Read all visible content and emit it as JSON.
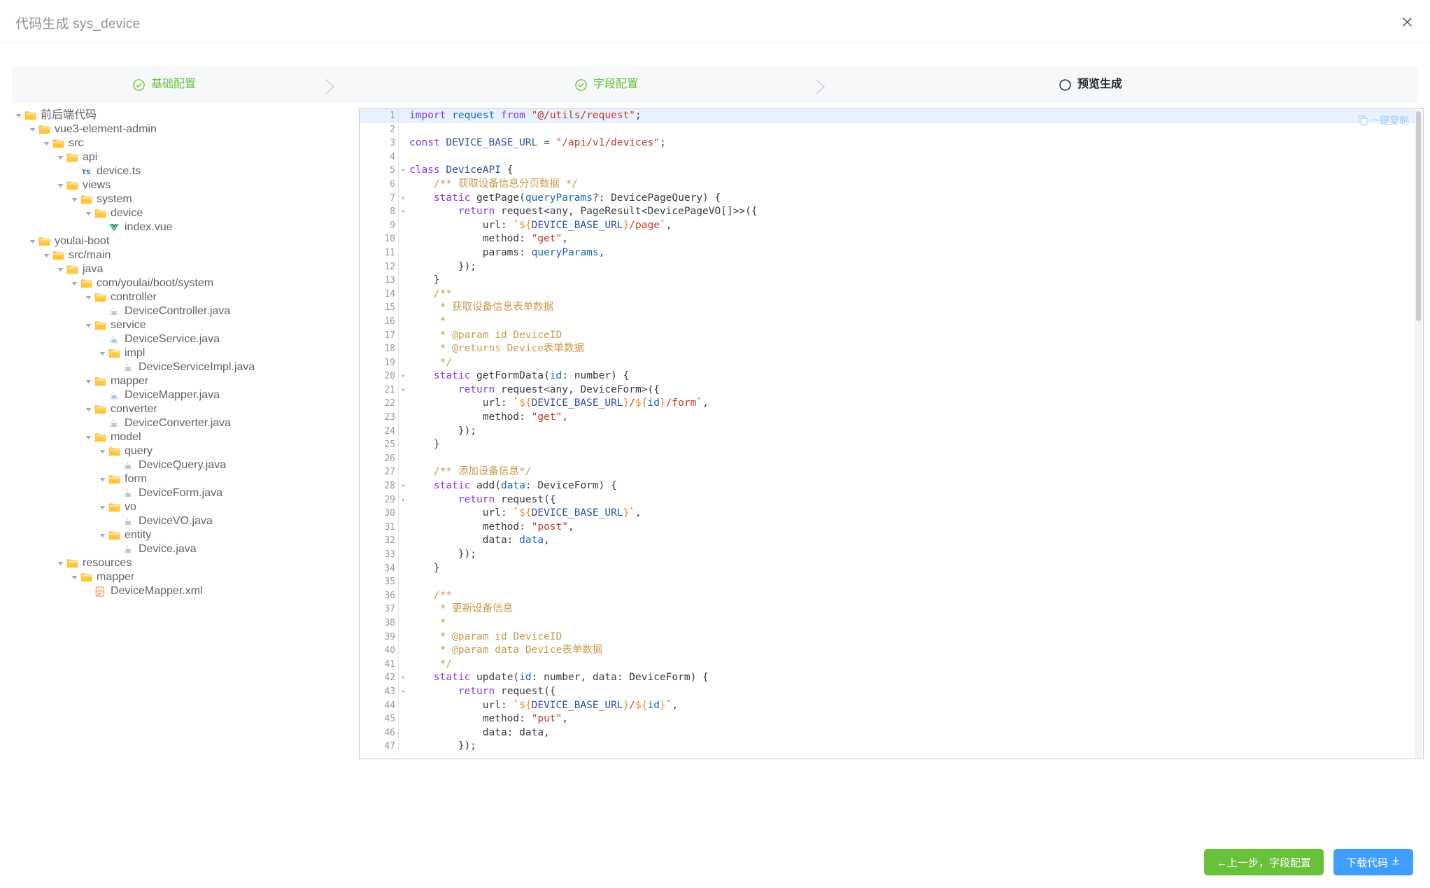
{
  "dialog": {
    "title": "代码生成 sys_device",
    "close_icon": "close-icon"
  },
  "steps": [
    {
      "label": "基础配置",
      "state": "done",
      "icon": "circle-check-icon"
    },
    {
      "label": "字段配置",
      "state": "done",
      "icon": "circle-check-icon"
    },
    {
      "label": "预览生成",
      "state": "active",
      "icon": "circle-icon"
    }
  ],
  "tree": [
    {
      "depth": 0,
      "label": "前后端代码",
      "type": "folder",
      "expanded": true
    },
    {
      "depth": 1,
      "label": "vue3-element-admin",
      "type": "folder",
      "expanded": true
    },
    {
      "depth": 2,
      "label": "src",
      "type": "folder",
      "expanded": true
    },
    {
      "depth": 3,
      "label": "api",
      "type": "folder",
      "expanded": true
    },
    {
      "depth": 4,
      "label": "device.ts",
      "type": "ts",
      "expanded": false
    },
    {
      "depth": 3,
      "label": "views",
      "type": "folder",
      "expanded": true
    },
    {
      "depth": 4,
      "label": "system",
      "type": "folder",
      "expanded": true
    },
    {
      "depth": 5,
      "label": "device",
      "type": "folder",
      "expanded": true
    },
    {
      "depth": 6,
      "label": "index.vue",
      "type": "vue",
      "expanded": false
    },
    {
      "depth": 1,
      "label": "youlai-boot",
      "type": "folder",
      "expanded": true
    },
    {
      "depth": 2,
      "label": "src/main",
      "type": "folder",
      "expanded": true
    },
    {
      "depth": 3,
      "label": "java",
      "type": "folder",
      "expanded": true
    },
    {
      "depth": 4,
      "label": "com/youlai/boot/system",
      "type": "folder",
      "expanded": true
    },
    {
      "depth": 5,
      "label": "controller",
      "type": "folder",
      "expanded": true
    },
    {
      "depth": 6,
      "label": "DeviceController.java",
      "type": "java",
      "expanded": false
    },
    {
      "depth": 5,
      "label": "service",
      "type": "folder",
      "expanded": true
    },
    {
      "depth": 6,
      "label": "DeviceService.java",
      "type": "java",
      "expanded": false
    },
    {
      "depth": 6,
      "label": "impl",
      "type": "folder",
      "expanded": true
    },
    {
      "depth": 7,
      "label": "DeviceServiceImpl.java",
      "type": "java",
      "expanded": false
    },
    {
      "depth": 5,
      "label": "mapper",
      "type": "folder",
      "expanded": true
    },
    {
      "depth": 6,
      "label": "DeviceMapper.java",
      "type": "java",
      "expanded": false
    },
    {
      "depth": 5,
      "label": "converter",
      "type": "folder",
      "expanded": true
    },
    {
      "depth": 6,
      "label": "DeviceConverter.java",
      "type": "java",
      "expanded": false
    },
    {
      "depth": 5,
      "label": "model",
      "type": "folder",
      "expanded": true
    },
    {
      "depth": 6,
      "label": "query",
      "type": "folder",
      "expanded": true
    },
    {
      "depth": 7,
      "label": "DeviceQuery.java",
      "type": "java",
      "expanded": false
    },
    {
      "depth": 6,
      "label": "form",
      "type": "folder",
      "expanded": true
    },
    {
      "depth": 7,
      "label": "DeviceForm.java",
      "type": "java",
      "expanded": false
    },
    {
      "depth": 6,
      "label": "vo",
      "type": "folder",
      "expanded": true
    },
    {
      "depth": 7,
      "label": "DeviceVO.java",
      "type": "java",
      "expanded": false
    },
    {
      "depth": 6,
      "label": "entity",
      "type": "folder",
      "expanded": true
    },
    {
      "depth": 7,
      "label": "Device.java",
      "type": "java",
      "expanded": false
    },
    {
      "depth": 3,
      "label": "resources",
      "type": "folder",
      "expanded": true
    },
    {
      "depth": 4,
      "label": "mapper",
      "type": "folder",
      "expanded": true
    },
    {
      "depth": 5,
      "label": "DeviceMapper.xml",
      "type": "xml",
      "expanded": false
    }
  ],
  "editor": {
    "copy_label": "一键复制",
    "copy_icon": "copy-icon",
    "active_line": 1,
    "fold_lines": [
      5,
      7,
      8,
      20,
      21,
      28,
      29,
      42,
      43
    ],
    "lines": [
      {
        "n": 1,
        "tokens": [
          [
            "kw",
            "import"
          ],
          [
            "plain",
            " "
          ],
          [
            "var",
            "request"
          ],
          [
            "plain",
            " "
          ],
          [
            "kw",
            "from"
          ],
          [
            "plain",
            " "
          ],
          [
            "str",
            "\"@/utils/request\""
          ],
          [
            "plain",
            ";"
          ]
        ]
      },
      {
        "n": 2,
        "tokens": []
      },
      {
        "n": 3,
        "tokens": [
          [
            "kw",
            "const"
          ],
          [
            "plain",
            " "
          ],
          [
            "const",
            "DEVICE_BASE_URL"
          ],
          [
            "plain",
            " = "
          ],
          [
            "str",
            "\"/api/v1/devices\""
          ],
          [
            "plain",
            ";"
          ]
        ]
      },
      {
        "n": 4,
        "tokens": []
      },
      {
        "n": 5,
        "tokens": [
          [
            "kw2",
            "class"
          ],
          [
            "plain",
            " "
          ],
          [
            "const",
            "DeviceAPI"
          ],
          [
            "plain",
            " {"
          ]
        ]
      },
      {
        "n": 6,
        "tokens": [
          [
            "plain",
            "    "
          ],
          [
            "cmt",
            "/** 获取设备信息分页数据 */"
          ]
        ]
      },
      {
        "n": 7,
        "tokens": [
          [
            "plain",
            "    "
          ],
          [
            "kw2",
            "static"
          ],
          [
            "plain",
            " getPage("
          ],
          [
            "var",
            "queryParams"
          ],
          [
            "plain",
            "?: DevicePageQuery) {"
          ]
        ]
      },
      {
        "n": 8,
        "tokens": [
          [
            "plain",
            "        "
          ],
          [
            "kw",
            "return"
          ],
          [
            "plain",
            " request<any, PageResult<DevicePageVO[]>>({"
          ]
        ]
      },
      {
        "n": 9,
        "tokens": [
          [
            "plain",
            "            url: "
          ],
          [
            "tpl",
            "`"
          ],
          [
            "int",
            "${"
          ],
          [
            "const",
            "DEVICE_BASE_URL"
          ],
          [
            "int",
            "}"
          ],
          [
            "tpl",
            "/page`"
          ],
          [
            "plain",
            ","
          ]
        ]
      },
      {
        "n": 10,
        "tokens": [
          [
            "plain",
            "            method: "
          ],
          [
            "str",
            "\"get\""
          ],
          [
            "plain",
            ","
          ]
        ]
      },
      {
        "n": 11,
        "tokens": [
          [
            "plain",
            "            params: "
          ],
          [
            "var",
            "queryParams"
          ],
          [
            "plain",
            ","
          ]
        ]
      },
      {
        "n": 12,
        "tokens": [
          [
            "plain",
            "        });"
          ]
        ]
      },
      {
        "n": 13,
        "tokens": [
          [
            "plain",
            "    }"
          ]
        ]
      },
      {
        "n": 14,
        "tokens": [
          [
            "plain",
            "    "
          ],
          [
            "cmt",
            "/**"
          ]
        ]
      },
      {
        "n": 15,
        "tokens": [
          [
            "plain",
            "     "
          ],
          [
            "cmt",
            "* 获取设备信息表单数据"
          ]
        ]
      },
      {
        "n": 16,
        "tokens": [
          [
            "plain",
            "     "
          ],
          [
            "cmt",
            "*"
          ]
        ]
      },
      {
        "n": 17,
        "tokens": [
          [
            "plain",
            "     "
          ],
          [
            "cmt",
            "* @param id DeviceID"
          ]
        ]
      },
      {
        "n": 18,
        "tokens": [
          [
            "plain",
            "     "
          ],
          [
            "cmt",
            "* @returns Device表单数据"
          ]
        ]
      },
      {
        "n": 19,
        "tokens": [
          [
            "plain",
            "     "
          ],
          [
            "cmt",
            "*/"
          ]
        ]
      },
      {
        "n": 20,
        "tokens": [
          [
            "plain",
            "    "
          ],
          [
            "kw2",
            "static"
          ],
          [
            "plain",
            " getFormData("
          ],
          [
            "var",
            "id"
          ],
          [
            "plain",
            ": number) {"
          ]
        ]
      },
      {
        "n": 21,
        "tokens": [
          [
            "plain",
            "        "
          ],
          [
            "kw",
            "return"
          ],
          [
            "plain",
            " request<any, DeviceForm>({"
          ]
        ]
      },
      {
        "n": 22,
        "tokens": [
          [
            "plain",
            "            url: "
          ],
          [
            "tpl",
            "`"
          ],
          [
            "int",
            "${"
          ],
          [
            "const",
            "DEVICE_BASE_URL"
          ],
          [
            "int",
            "}"
          ],
          [
            "tpl",
            "/"
          ],
          [
            "int",
            "${"
          ],
          [
            "var",
            "id"
          ],
          [
            "int",
            "}"
          ],
          [
            "tpl",
            "/form`"
          ],
          [
            "plain",
            ","
          ]
        ]
      },
      {
        "n": 23,
        "tokens": [
          [
            "plain",
            "            method: "
          ],
          [
            "str",
            "\"get\""
          ],
          [
            "plain",
            ","
          ]
        ]
      },
      {
        "n": 24,
        "tokens": [
          [
            "plain",
            "        });"
          ]
        ]
      },
      {
        "n": 25,
        "tokens": [
          [
            "plain",
            "    }"
          ]
        ]
      },
      {
        "n": 26,
        "tokens": []
      },
      {
        "n": 27,
        "tokens": [
          [
            "plain",
            "    "
          ],
          [
            "cmt",
            "/** 添加设备信息*/"
          ]
        ]
      },
      {
        "n": 28,
        "tokens": [
          [
            "plain",
            "    "
          ],
          [
            "kw2",
            "static"
          ],
          [
            "plain",
            " add("
          ],
          [
            "var",
            "data"
          ],
          [
            "plain",
            ": DeviceForm) {"
          ]
        ]
      },
      {
        "n": 29,
        "tokens": [
          [
            "plain",
            "        "
          ],
          [
            "kw",
            "return"
          ],
          [
            "plain",
            " request({"
          ]
        ]
      },
      {
        "n": 30,
        "tokens": [
          [
            "plain",
            "            url: "
          ],
          [
            "tpl",
            "`"
          ],
          [
            "int",
            "${"
          ],
          [
            "const",
            "DEVICE_BASE_URL"
          ],
          [
            "int",
            "}"
          ],
          [
            "tpl",
            "`"
          ],
          [
            "plain",
            ","
          ]
        ]
      },
      {
        "n": 31,
        "tokens": [
          [
            "plain",
            "            method: "
          ],
          [
            "str",
            "\"post\""
          ],
          [
            "plain",
            ","
          ]
        ]
      },
      {
        "n": 32,
        "tokens": [
          [
            "plain",
            "            data: "
          ],
          [
            "var",
            "data"
          ],
          [
            "plain",
            ","
          ]
        ]
      },
      {
        "n": 33,
        "tokens": [
          [
            "plain",
            "        });"
          ]
        ]
      },
      {
        "n": 34,
        "tokens": [
          [
            "plain",
            "    }"
          ]
        ]
      },
      {
        "n": 35,
        "tokens": []
      },
      {
        "n": 36,
        "tokens": [
          [
            "plain",
            "    "
          ],
          [
            "cmt",
            "/**"
          ]
        ]
      },
      {
        "n": 37,
        "tokens": [
          [
            "plain",
            "     "
          ],
          [
            "cmt",
            "* 更新设备信息"
          ]
        ]
      },
      {
        "n": 38,
        "tokens": [
          [
            "plain",
            "     "
          ],
          [
            "cmt",
            "*"
          ]
        ]
      },
      {
        "n": 39,
        "tokens": [
          [
            "plain",
            "     "
          ],
          [
            "cmt",
            "* @param id DeviceID"
          ]
        ]
      },
      {
        "n": 40,
        "tokens": [
          [
            "plain",
            "     "
          ],
          [
            "cmt",
            "* @param data Device表单数据"
          ]
        ]
      },
      {
        "n": 41,
        "tokens": [
          [
            "plain",
            "     "
          ],
          [
            "cmt",
            "*/"
          ]
        ]
      },
      {
        "n": 42,
        "tokens": [
          [
            "plain",
            "    "
          ],
          [
            "kw2",
            "static"
          ],
          [
            "plain",
            " update("
          ],
          [
            "var",
            "id"
          ],
          [
            "plain",
            ": number, data: DeviceForm) {"
          ]
        ]
      },
      {
        "n": 43,
        "tokens": [
          [
            "plain",
            "        "
          ],
          [
            "kw",
            "return"
          ],
          [
            "plain",
            " request({"
          ]
        ]
      },
      {
        "n": 44,
        "tokens": [
          [
            "plain",
            "            url: "
          ],
          [
            "tpl",
            "`"
          ],
          [
            "int",
            "${"
          ],
          [
            "const",
            "DEVICE_BASE_URL"
          ],
          [
            "int",
            "}"
          ],
          [
            "tpl",
            "/"
          ],
          [
            "int",
            "${"
          ],
          [
            "var",
            "id"
          ],
          [
            "int",
            "}"
          ],
          [
            "tpl",
            "`"
          ],
          [
            "plain",
            ","
          ]
        ]
      },
      {
        "n": 45,
        "tokens": [
          [
            "plain",
            "            method: "
          ],
          [
            "str",
            "\"put\""
          ],
          [
            "plain",
            ","
          ]
        ]
      },
      {
        "n": 46,
        "tokens": [
          [
            "plain",
            "            data: data,"
          ]
        ]
      },
      {
        "n": 47,
        "tokens": [
          [
            "plain",
            "        });"
          ]
        ]
      }
    ]
  },
  "footer": {
    "prev_label": "←上一步，字段配置",
    "download_label": "下载代码",
    "download_icon": "download-icon"
  },
  "colors": {
    "green": "#67c23a",
    "blue": "#409eff",
    "folder": "#ffc53d",
    "step_bar": "#f7f8fa",
    "active_line": "#e8f2fe"
  }
}
